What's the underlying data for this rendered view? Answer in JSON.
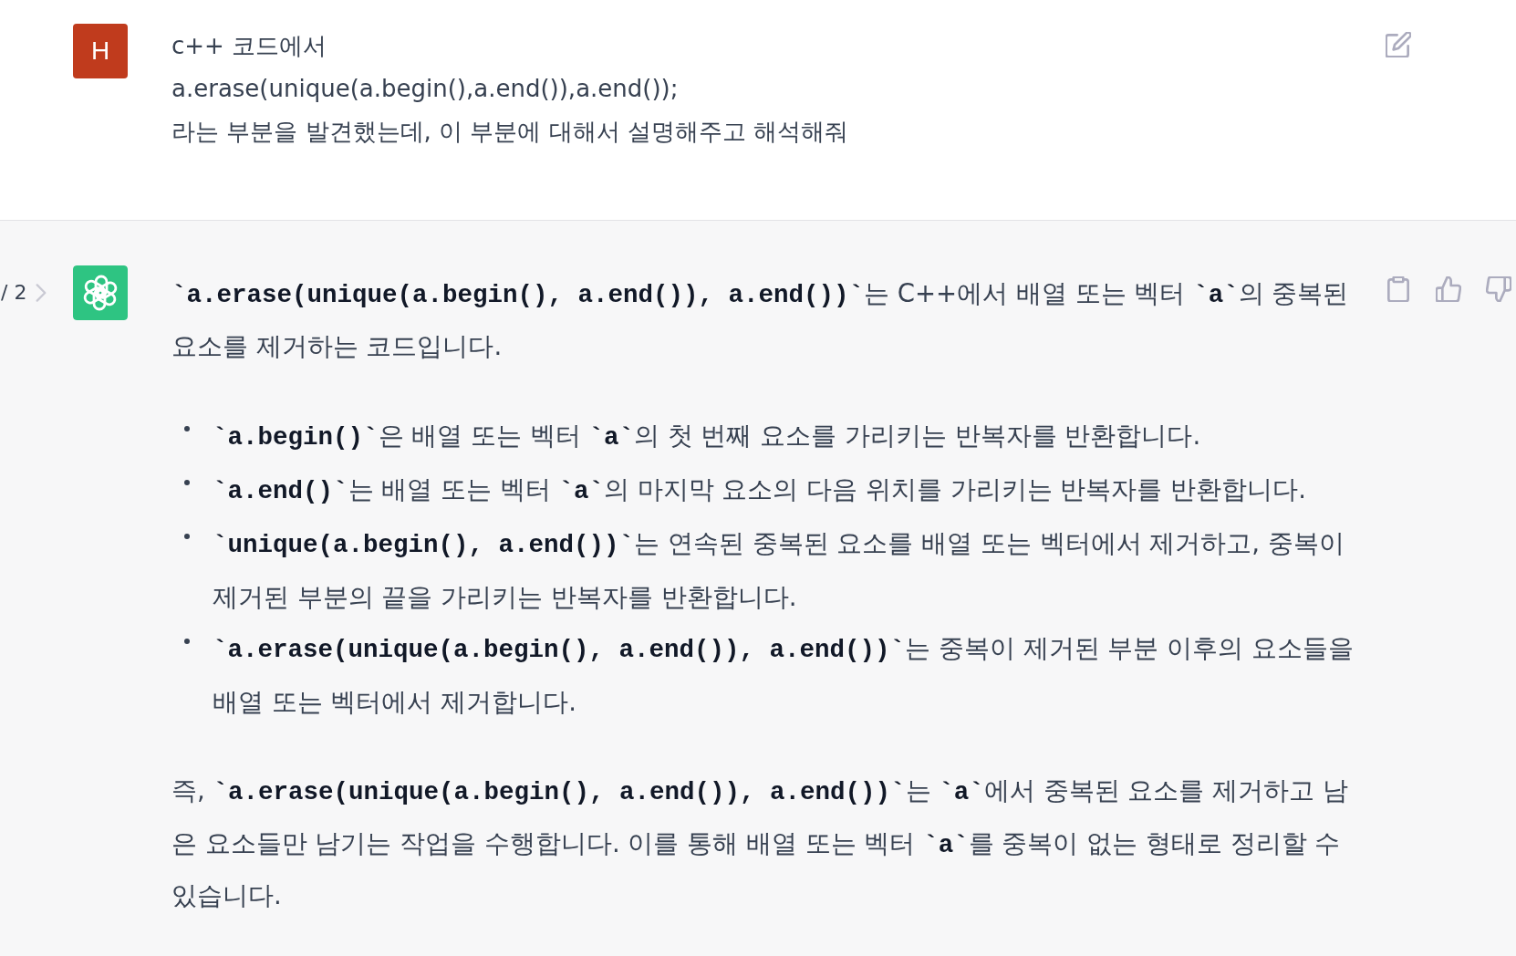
{
  "conversation": [
    {
      "kind": "prompt",
      "avatar_initial": "H",
      "text": "c++ 코드에서\na.erase(unique(a.begin(),a.end()),a.end());\n라는 부분을 발견했는데, 이 부분에 대해서 설명해주고 해석해줘"
    },
    {
      "kind": "response",
      "pager": "/ 2",
      "blocks": [
        {
          "kind": "paragraph",
          "text": "**`a.erase(unique(a.begin(), a.end()), a.end())`**는 C++에서 배열 또는 벡터 **`a`**의 중복된 요소를 제거하는 코드입니다."
        },
        {
          "kind": "list",
          "items": [
            "**`a.begin()`**은 배열 또는 벡터 **`a`**의 첫 번째 요소를 가리키는 반복자를 반환합니다.",
            "**`a.end()`**는 배열 또는 벡터 **`a`**의 마지막 요소의 다음 위치를 가리키는 반복자를 반환합니다.",
            "**`unique(a.begin(), a.end())`**는 연속된 중복된 요소를 배열 또는 벡터에서 제거하고, 중복이 제거된 부분의 끝을 가리키는 반복자를 반환합니다.",
            "**`a.erase(unique(a.begin(), a.end()), a.end())`**는 중복이 제거된 부분 이후의 요소들을 배열 또는 벡터에서 제거합니다."
          ]
        },
        {
          "kind": "paragraph",
          "text": "즉, **`a.erase(unique(a.begin(), a.end()), a.end())`**는 **`a`**에서 중복된 요소를 제거하고 남은 요소들만 남기는 작업을 수행합니다. 이를 통해 배열 또는 벡터 **`a`**를 중복이 없는 형태로 정리할 수 있습니다."
        }
      ]
    }
  ]
}
